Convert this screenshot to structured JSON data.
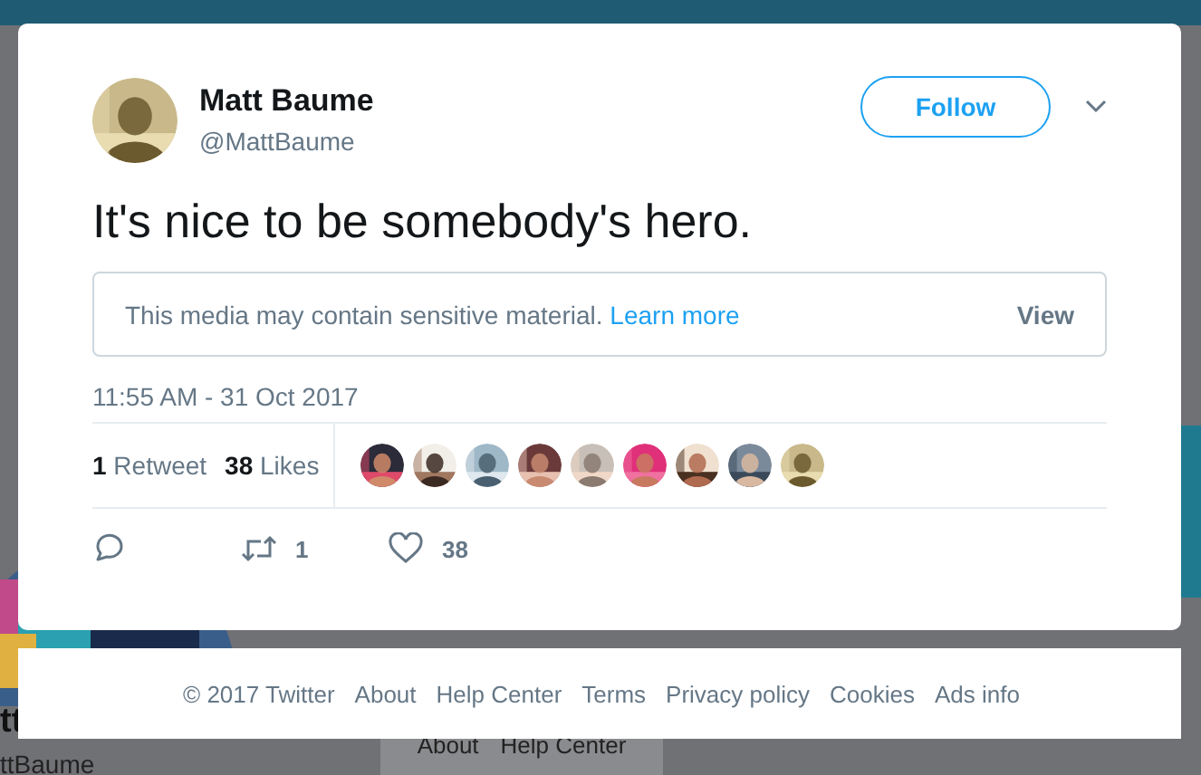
{
  "background": {
    "name_fragment": "tt",
    "handle_fragment": "ttBaume",
    "links": [
      "About",
      "Help Center"
    ]
  },
  "tweet": {
    "author": {
      "name": "Matt Baume",
      "handle": "@MattBaume"
    },
    "follow_button": "Follow",
    "text": "It's nice to be somebody's hero.",
    "sensitive_notice": {
      "text": "This media may contain sensitive material.",
      "link": "Learn more",
      "action": "View"
    },
    "timestamp": "11:55 AM - 31 Oct 2017",
    "stats": [
      {
        "count": "1",
        "label": "Retweet"
      },
      {
        "count": "38",
        "label": "Likes"
      }
    ],
    "actions": [
      {
        "kind": "reply"
      },
      {
        "kind": "retweet",
        "count": "1"
      },
      {
        "kind": "like",
        "count": "38"
      }
    ]
  },
  "footer": [
    "© 2017 Twitter",
    "About",
    "Help Center",
    "Terms",
    "Privacy policy",
    "Cookies",
    "Ads info"
  ]
}
